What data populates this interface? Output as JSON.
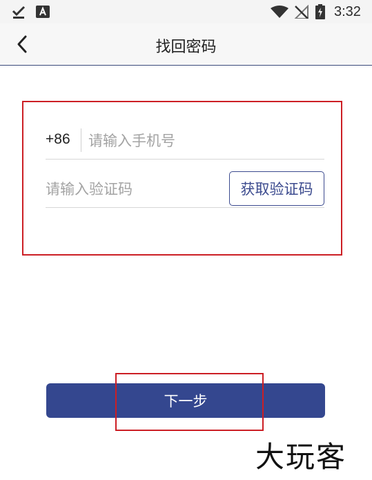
{
  "status_bar": {
    "time": "3:32",
    "icons": [
      "download-done-icon",
      "keyboard-a-icon",
      "wifi-icon",
      "no-signal-icon",
      "battery-charging-icon"
    ]
  },
  "app_bar": {
    "back_icon": "chevron-left-icon",
    "title": "找回密码"
  },
  "form": {
    "country_code": "+86",
    "phone_placeholder": "请输入手机号",
    "phone_value": "",
    "code_placeholder": "请输入验证码",
    "code_value": "",
    "get_code_label": "获取验证码"
  },
  "next_button": {
    "label": "下一步"
  },
  "watermark": "大玩客",
  "colors": {
    "accent": "#34478f",
    "highlight": "#cc1e24",
    "placeholder": "#a3a3a3"
  }
}
